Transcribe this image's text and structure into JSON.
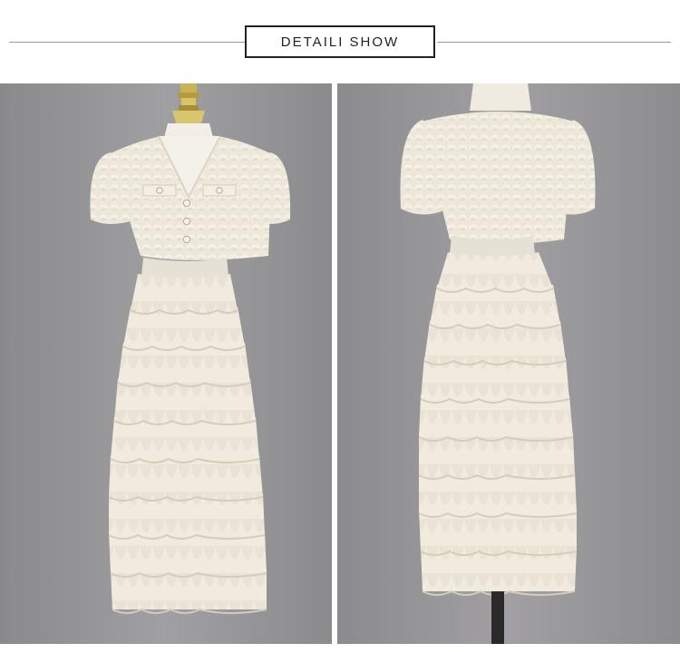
{
  "header": {
    "title": "DETAILI SHOW"
  },
  "photos": [
    {
      "view": "front"
    },
    {
      "view": "back"
    }
  ],
  "colors": {
    "background": "#8f8f91",
    "dress": "#efe9dc",
    "ruffle_shadow": "#d6cfbf",
    "waistband": "#e4dfd2",
    "mannequin_base": "#c8b45a"
  }
}
